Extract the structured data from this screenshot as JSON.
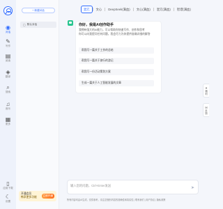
{
  "rail": {
    "items": [
      {
        "icon": "chat-bubble-icon",
        "glyph": "◉",
        "label": "对话",
        "active": true
      },
      {
        "icon": "pen-icon",
        "glyph": "✎",
        "label": "写作",
        "active": false
      },
      {
        "icon": "book-icon",
        "glyph": "▤",
        "label": "阅读",
        "active": false
      },
      {
        "icon": "translate-icon",
        "glyph": "◈",
        "label": "翻译",
        "active": false
      },
      {
        "icon": "search-icon",
        "glyph": "⌕",
        "label": "搜索",
        "active": false
      },
      {
        "icon": "music-icon",
        "glyph": "♫",
        "label": "音乐",
        "active": false
      },
      {
        "icon": "grid-icon",
        "glyph": "▦",
        "label": "更多",
        "active": false
      }
    ],
    "bottom": [
      {
        "icon": "mobile-icon",
        "glyph": "▯",
        "label": "应用下载"
      },
      {
        "icon": "moon-icon",
        "glyph": "☾",
        "label": "设置"
      }
    ]
  },
  "sidebar": {
    "new_chat_label": "+ 新建对话",
    "conversation": "默认对话",
    "promo_line1": "开通会员",
    "promo_line2": "畅享更多功能",
    "promo_button": "立即开通"
  },
  "tabs": [
    {
      "label": "混元",
      "active": true
    },
    {
      "label": "文心",
      "active": false
    },
    {
      "label": "DeepSeek(满血)",
      "active": false
    },
    {
      "label": "文心(满血)",
      "active": false
    },
    {
      "label": "混元(满血)",
      "active": false
    },
    {
      "label": "智谱(满血)",
      "active": false
    }
  ],
  "welcome": {
    "title": "你好，我是AI创作助手",
    "desc1": "我拥有强大的AI能力，可以帮助你快速写作、创作和思考",
    "desc2": "你可以向我提问任何问题，我会尽力为你提供准确详细的解答",
    "suggestions": [
      "帮我写一篇关于工作的总结",
      "帮我写一篇关于旅行的游记",
      "帮我写一份活动策划方案",
      "生成一篇关于人工智能发展的文章"
    ]
  },
  "side_buttons": [
    {
      "icon": "gift-icon",
      "glyph": "✦",
      "label": "福利"
    },
    {
      "icon": "feedback-icon",
      "glyph": "✉",
      "label": "反馈"
    }
  ],
  "input": {
    "placeholder": "输入您的问题，Ctrl+Enter发送",
    "send_glyph": "➤"
  },
  "disclaimer": "所有内容均由AI生成，仅供参考，请注意甄别内容的准确性和真实性 | 联系我们 | 用户协议 | 隐私政策"
}
